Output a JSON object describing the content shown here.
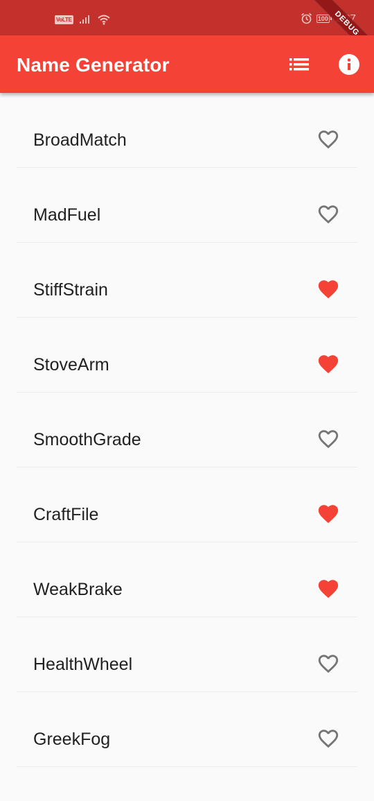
{
  "status_bar": {
    "volte": "VoLTE",
    "battery": "100",
    "time": "2:27"
  },
  "debug_banner": "DEBUG",
  "app_bar": {
    "title": "Name Generator",
    "actions": [
      "list-icon",
      "info-icon"
    ]
  },
  "colors": {
    "accent": "#f44336",
    "status_bar": "#c4302b",
    "favorite": "#f44336",
    "unfavorite": "#757575"
  },
  "names": [
    {
      "label": "BroadMatch",
      "favorite": false
    },
    {
      "label": "MadFuel",
      "favorite": false
    },
    {
      "label": "StiffStrain",
      "favorite": true
    },
    {
      "label": "StoveArm",
      "favorite": true
    },
    {
      "label": "SmoothGrade",
      "favorite": false
    },
    {
      "label": "CraftFile",
      "favorite": true
    },
    {
      "label": "WeakBrake",
      "favorite": true
    },
    {
      "label": "HealthWheel",
      "favorite": false
    },
    {
      "label": "GreekFog",
      "favorite": false
    }
  ]
}
